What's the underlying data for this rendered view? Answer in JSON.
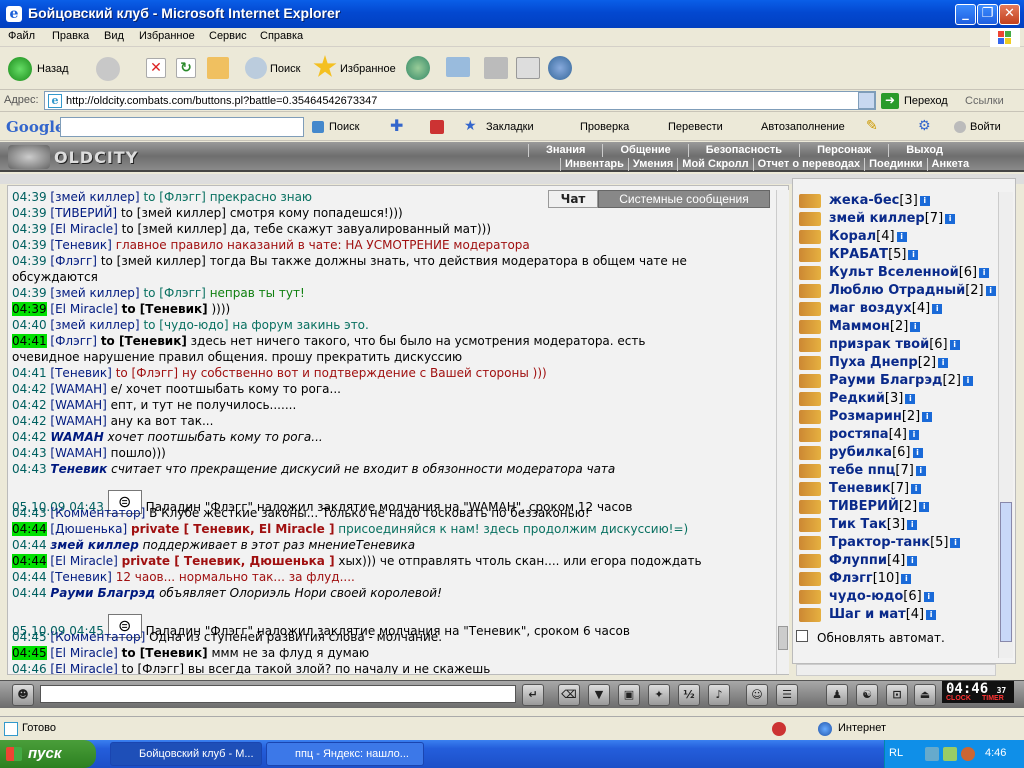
{
  "window": {
    "title": "Бойцовский клуб - Microsoft Internet Explorer"
  },
  "menu": [
    "Файл",
    "Правка",
    "Вид",
    "Избранное",
    "Сервис",
    "Справка"
  ],
  "toolbar": {
    "back": "Назад",
    "search": "Поиск",
    "favorites": "Избранное"
  },
  "address": {
    "label": "Адрес:",
    "url": "http://oldcity.combats.com/buttons.pl?battle=0.35464542673347",
    "go": "Переход",
    "links": "Ссылки"
  },
  "google": {
    "brand": "Google",
    "search": "Поиск",
    "bookmarks": "Закладки",
    "check": "Проверка",
    "translate": "Перевести",
    "autofill": "Автозаполнение",
    "signin": "Войти"
  },
  "game": {
    "logo": "OLDCITY",
    "nav_top": [
      "Знания",
      "Общение",
      "Безопасность",
      "Персонаж",
      "Выход"
    ],
    "nav_bottom": [
      "Инвентарь",
      "Умения",
      "Мой Скролл",
      "Отчет о переводах",
      "Поединки",
      "Анкета"
    ]
  },
  "tabs": {
    "chat": "Чат",
    "system": "Системные сообщения"
  },
  "chat_lines": [
    {
      "time": "04:39",
      "name": "[змей киллер]",
      "target": "to [Флэгг]",
      "text": "прекрасно знаю",
      "kind": "teal"
    },
    {
      "time": "04:39",
      "name": "[ТИВЕРИЙ]",
      "target": "to [змей киллер]",
      "text": "смотря кому попадешся!)))",
      "kind": "plain"
    },
    {
      "time": "04:39",
      "name": "[El Miracle]",
      "target": "to [змей киллер]",
      "text": "да, тебе скажут завуалированный мат)))",
      "kind": "plain"
    },
    {
      "time": "04:39",
      "name": "[Теневик]",
      "target": "",
      "text": "главное правило наказаний в чате: НА УСМОТРЕНИЕ модератора",
      "kind": "red"
    },
    {
      "time": "04:39",
      "name": "[Флэгг]",
      "target": "to [змей киллер]",
      "text": "тогда Вы также должны знать, что действия модератора в общем чате не",
      "kind": "plain"
    },
    {
      "time": "",
      "name": "",
      "target": "",
      "text": "обсуждаются",
      "kind": "plain"
    },
    {
      "time": "04:39",
      "name": "[змей киллер]",
      "target": "to [Флэгг]",
      "text": "неправ ты тут!",
      "kind": "green"
    },
    {
      "time": "04:39",
      "name": "[El Miracle]",
      "target": "to [Теневик]",
      "text": "))))",
      "kind": "hl"
    },
    {
      "time": "04:40",
      "name": "[змей киллер]",
      "target": "to [чудо-юдо]",
      "text": "на форум закинь это.",
      "kind": "teal"
    },
    {
      "time": "04:41",
      "name": "[Флэгг]",
      "target": "to [Теневик]",
      "text": "здесь нет ничего такого, что бы было на усмотрения модератора. есть",
      "kind": "hl"
    },
    {
      "time": "",
      "name": "",
      "target": "",
      "text": "очевидное нарушение правил общения. прошу прекратить дискуссию",
      "kind": "plain"
    },
    {
      "time": "04:41",
      "name": "[Теневик]",
      "target": "to [Флэгг]",
      "text": "ну собственно вот и подтверждение с Вашей стороны )))",
      "kind": "red"
    },
    {
      "time": "04:42",
      "name": "[WAMAH]",
      "target": "",
      "text": "е/ хочет поотшыбать кому то рога...",
      "kind": "plain"
    },
    {
      "time": "04:42",
      "name": "[WAMAH]",
      "target": "",
      "text": "епт, и тут не получилось.......",
      "kind": "plain"
    },
    {
      "time": "04:42",
      "name": "[WAMAH]",
      "target": "",
      "text": "ану ка вот так...",
      "kind": "plain"
    },
    {
      "time": "04:42",
      "name": "WAMAH",
      "target": "",
      "text": "хочет поотшыбать кому то рога...",
      "kind": "emote"
    },
    {
      "time": "04:43",
      "name": "[WAMAH]",
      "target": "",
      "text": "пошло)))",
      "kind": "plain"
    },
    {
      "time": "04:43",
      "name": "Теневик",
      "target": "",
      "text": "считает что прекращение дискусий не входит в обязонности модератора чата",
      "kind": "emote"
    },
    {
      "time": "05.10.09 04:43",
      "name": "",
      "target": "",
      "text": "Паладин \"Флэгг\" наложил заклятие молчания на \"WAMAH\", сроком 12 часов",
      "kind": "sys"
    },
    {
      "time": "04:43",
      "name": "[Комментатор]",
      "target": "",
      "text": "В Клубе жесткие законы... Только не надо тосковать по беззаконью!",
      "kind": "plain"
    },
    {
      "time": "04:44",
      "name": "[Дюшенька]",
      "target": "private [ Теневик, El Miracle ]",
      "text": "присоединяйся к нам! здесь продолжим дискуссию!=)",
      "kind": "priv"
    },
    {
      "time": "04:44",
      "name": "змей киллер",
      "target": "",
      "text": "поддерживает в этот раз мнениеТеневика",
      "kind": "emote"
    },
    {
      "time": "04:44",
      "name": "[El Miracle]",
      "target": "private [ Теневик, Дюшенька ]",
      "text": "хых))) че отправлять чтоль скан.... или егора подождать",
      "kind": "priv2"
    },
    {
      "time": "04:44",
      "name": "[Теневик]",
      "target": "",
      "text": "12 чаов... нормально так... за флуд....",
      "kind": "red"
    },
    {
      "time": "04:44",
      "name": "Рауми Благрэд",
      "target": "",
      "text": "объявляет Олориэль Нори своей королевой!",
      "kind": "emote2"
    },
    {
      "time": "05.10.09 04:45",
      "name": "",
      "target": "",
      "text": "Паладин \"Флэгг\" наложил заклятие молчания на \"Теневик\", сроком 6 часов",
      "kind": "sys"
    },
    {
      "time": "04:45",
      "name": "[Комментатор]",
      "target": "",
      "text": "Одна из ступеней развития слова - молчание.",
      "kind": "plain"
    },
    {
      "time": "04:45",
      "name": "[El Miracle]",
      "target": "to [Теневик]",
      "text": "ммм не за флуд я думаю",
      "kind": "hl"
    },
    {
      "time": "04:46",
      "name": "[El Miracle]",
      "target": "to [Флэгг]",
      "text": "вы всегда такой злой? по началу и не скажешь",
      "kind": "plain"
    }
  ],
  "users": [
    {
      "name": "жека-бес",
      "lvl": "[3]"
    },
    {
      "name": "змей киллер",
      "lvl": "[7]"
    },
    {
      "name": "Корал",
      "lvl": "[4]"
    },
    {
      "name": "КРАБАТ",
      "lvl": "[5]"
    },
    {
      "name": "Культ Вселенной",
      "lvl": "[6]"
    },
    {
      "name": "Люблю Отрадный",
      "lvl": "[2]"
    },
    {
      "name": "маг воздух",
      "lvl": "[4]"
    },
    {
      "name": "Маммон",
      "lvl": "[2]"
    },
    {
      "name": "призрак твой",
      "lvl": "[6]"
    },
    {
      "name": "Пуха Днепр",
      "lvl": "[2]"
    },
    {
      "name": "Рауми Благрэд",
      "lvl": "[2]"
    },
    {
      "name": "Редкий",
      "lvl": "[3]"
    },
    {
      "name": "Розмарин",
      "lvl": "[2]"
    },
    {
      "name": "ростяпа",
      "lvl": "[4]"
    },
    {
      "name": "рубилка",
      "lvl": "[6]"
    },
    {
      "name": "тебе ппц",
      "lvl": "[7]"
    },
    {
      "name": "Теневик",
      "lvl": "[7]"
    },
    {
      "name": "ТИВЕРИЙ",
      "lvl": "[2]"
    },
    {
      "name": "Тик Так",
      "lvl": "[3]"
    },
    {
      "name": "Трактор-танк",
      "lvl": "[5]"
    },
    {
      "name": "Флуппи",
      "lvl": "[4]"
    },
    {
      "name": "Флэгг",
      "lvl": "[10]"
    },
    {
      "name": "чудо-юдо",
      "lvl": "[6]"
    },
    {
      "name": "Шаг и мат",
      "lvl": "[4]"
    }
  ],
  "auto_refresh": "Обновлять автомат.",
  "clock": {
    "time": "04:46",
    "sec": "37",
    "clock_label": "CLOCK",
    "timer_label": "TIMER"
  },
  "status": {
    "ready": "Готово",
    "zone": "Интернет"
  },
  "taskbar": {
    "start": "пуск",
    "task1": "Бойцовский клуб - M...",
    "task2": "ппц - Яндекс: нашло...",
    "lang": "RL",
    "time": "4:46"
  }
}
